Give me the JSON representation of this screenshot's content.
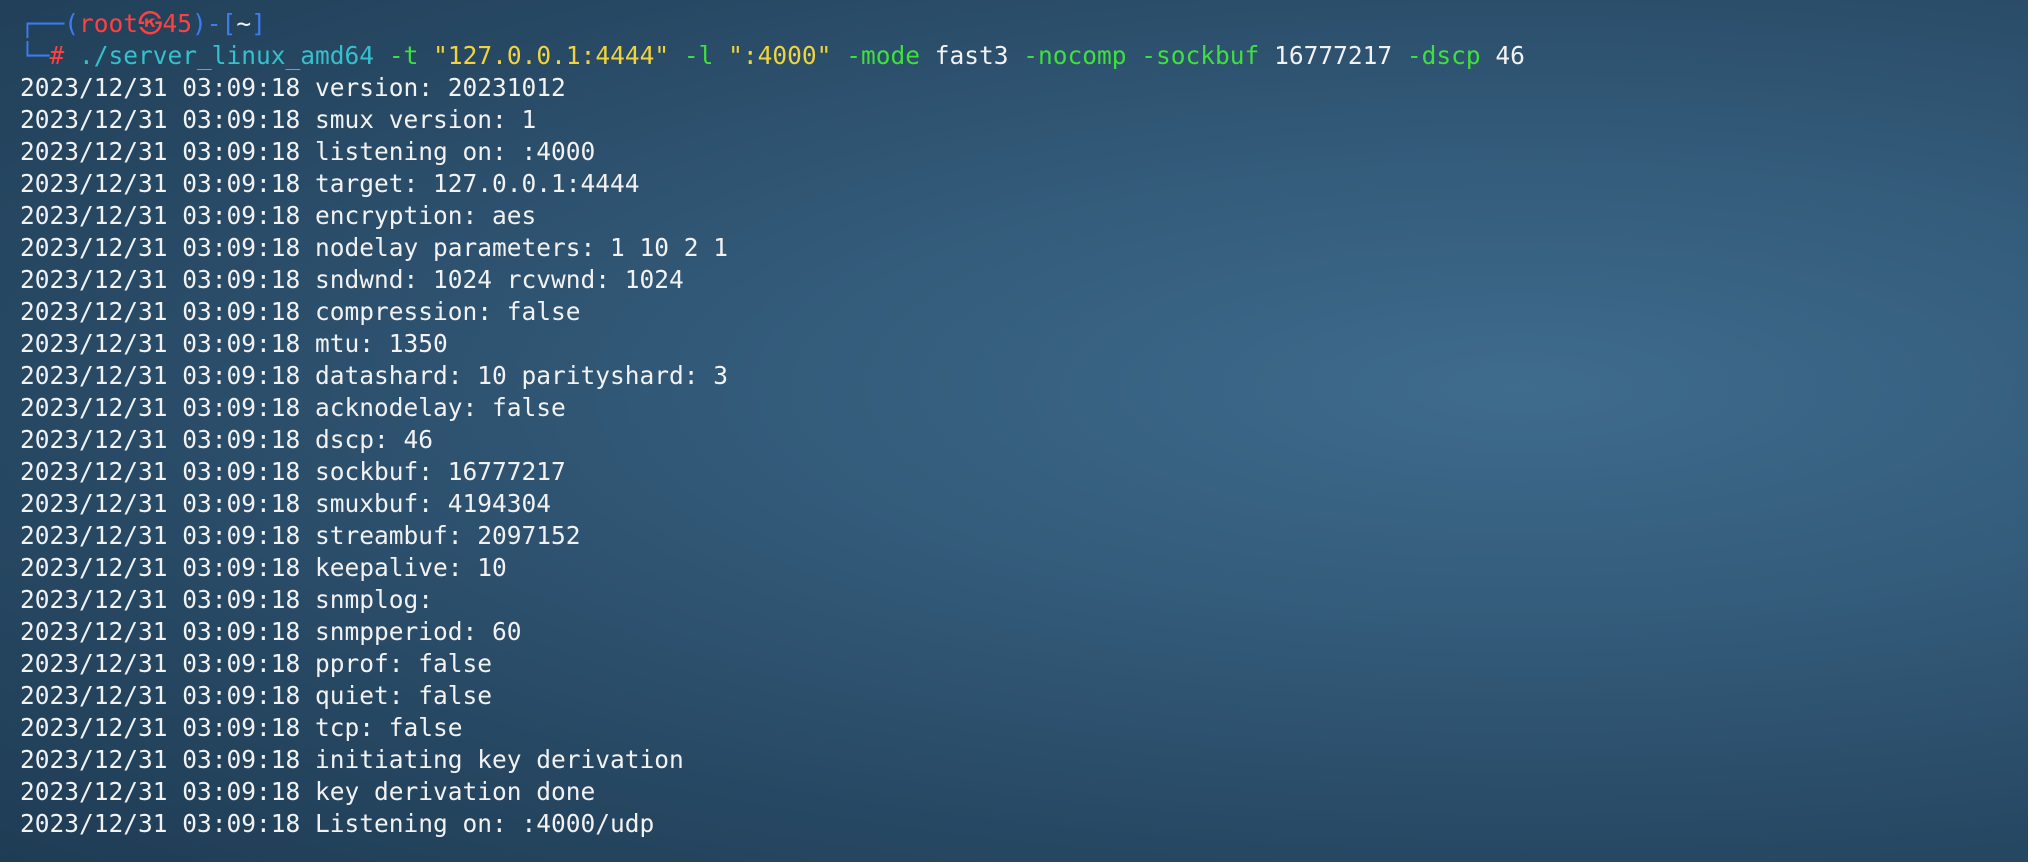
{
  "prompt": {
    "top_left": "┌──(",
    "user": "root",
    "at_symbol": "㉿",
    "host": "45",
    "mid": ")-[",
    "cwd": "~",
    "close": "]",
    "bottom_left": "└─",
    "hash": "#"
  },
  "command": {
    "executable": "./server_linux_amd64",
    "flag_t": "-t",
    "val_t": "\"127.0.0.1:4444\"",
    "flag_l": "-l",
    "val_l": "\":4000\"",
    "flag_mode": "-mode",
    "val_mode": "fast3",
    "flag_nocomp": "-nocomp",
    "flag_sockbuf": "-sockbuf",
    "val_sockbuf": "16777217",
    "flag_dscp": "-dscp",
    "val_dscp": "46"
  },
  "output_lines": [
    "2023/12/31 03:09:18 version: 20231012",
    "2023/12/31 03:09:18 smux version: 1",
    "2023/12/31 03:09:18 listening on: :4000",
    "2023/12/31 03:09:18 target: 127.0.0.1:4444",
    "2023/12/31 03:09:18 encryption: aes",
    "2023/12/31 03:09:18 nodelay parameters: 1 10 2 1",
    "2023/12/31 03:09:18 sndwnd: 1024 rcvwnd: 1024",
    "2023/12/31 03:09:18 compression: false",
    "2023/12/31 03:09:18 mtu: 1350",
    "2023/12/31 03:09:18 datashard: 10 parityshard: 3",
    "2023/12/31 03:09:18 acknodelay: false",
    "2023/12/31 03:09:18 dscp: 46",
    "2023/12/31 03:09:18 sockbuf: 16777217",
    "2023/12/31 03:09:18 smuxbuf: 4194304",
    "2023/12/31 03:09:18 streambuf: 2097152",
    "2023/12/31 03:09:18 keepalive: 10",
    "2023/12/31 03:09:18 snmplog:",
    "2023/12/31 03:09:18 snmpperiod: 60",
    "2023/12/31 03:09:18 pprof: false",
    "2023/12/31 03:09:18 quiet: false",
    "2023/12/31 03:09:18 tcp: false",
    "2023/12/31 03:09:18 initiating key derivation",
    "2023/12/31 03:09:18 key derivation done",
    "2023/12/31 03:09:18 Listening on: :4000/udp"
  ],
  "colors": {
    "prompt_frame": "#3c7cf0",
    "prompt_user": "#ff4040",
    "command_exec": "#36c0cc",
    "command_flag": "#3ee03e",
    "command_string": "#f1d43c",
    "text": "#f2f2f2"
  }
}
